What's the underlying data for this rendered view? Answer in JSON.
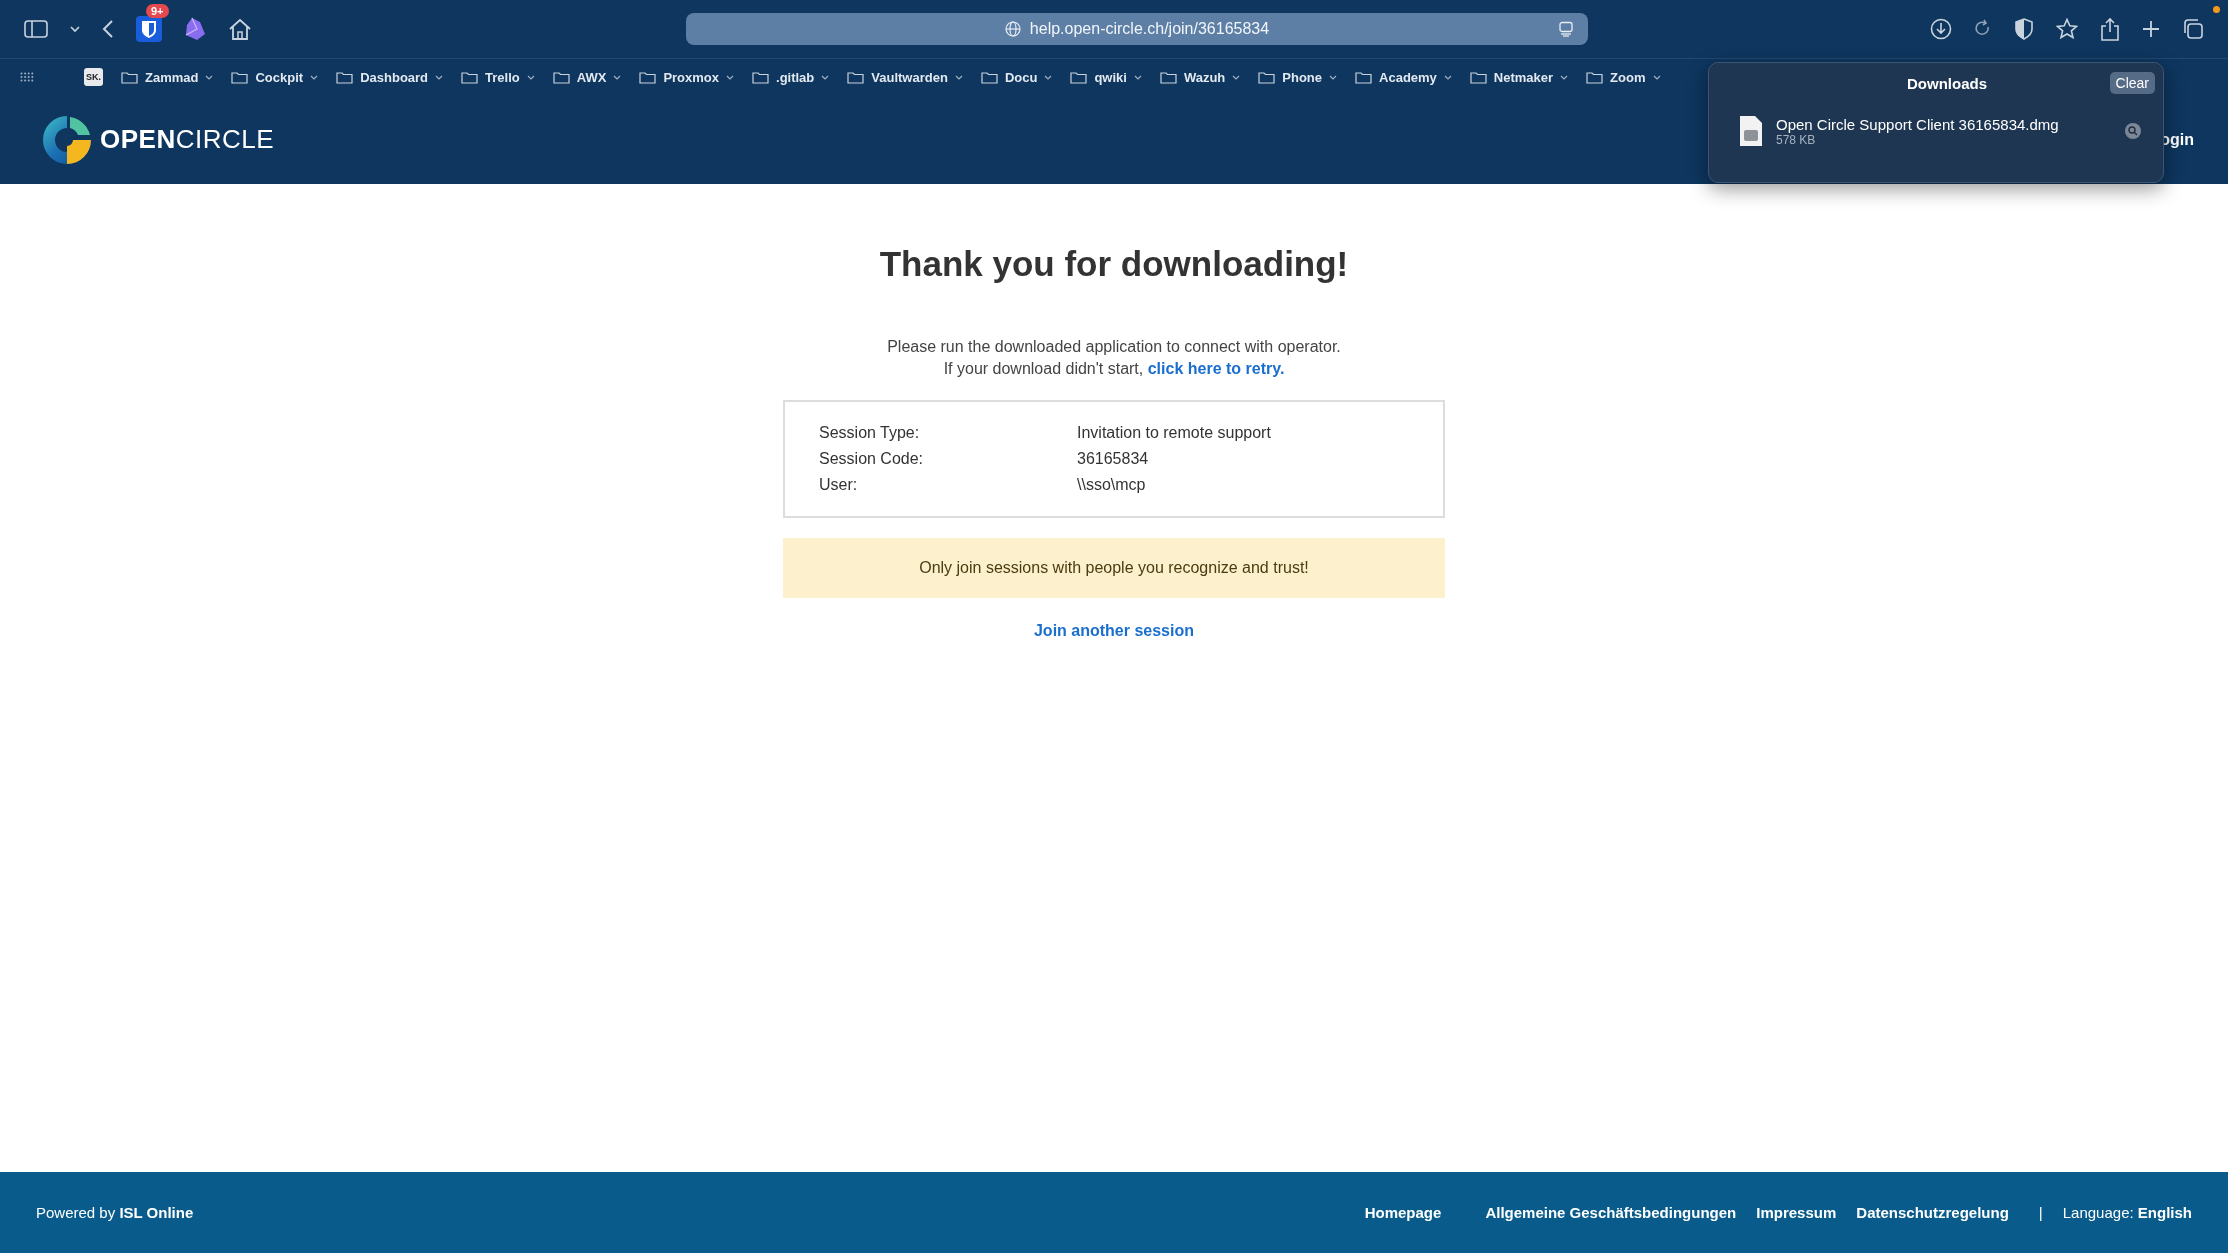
{
  "toolbar": {
    "extension_badge": "9+",
    "url": "help.open-circle.ch/join/36165834"
  },
  "bookmarks": {
    "favicon_text": "SK.",
    "folders": [
      "Zammad",
      "Cockpit",
      "Dashboard",
      "Trello",
      "AWX",
      "Proxmox",
      ".gitlab",
      "Vaultwarden",
      "Docu",
      "qwiki",
      "Wazuh",
      "Phone",
      "Academy",
      "Netmaker",
      "Zoom"
    ]
  },
  "site_header": {
    "logo": {
      "strong": "OPEN",
      "light": "CIRCLE"
    },
    "login": "ogin"
  },
  "downloads_popup": {
    "title": "Downloads",
    "clear": "Clear",
    "items": [
      {
        "name": "Open Circle Support Client 36165834.dmg",
        "size": "578 KB"
      }
    ]
  },
  "main": {
    "title": "Thank you for downloading!",
    "line_1": "Please run the downloaded application to connect with operator.",
    "line_2": "If your download didn't start,",
    "retry_link": "click here to retry.",
    "session": [
      {
        "label": "Session Type:",
        "value": "Invitation to remote support"
      },
      {
        "label": "Session Code:",
        "value": "36165834"
      },
      {
        "label": "User:",
        "value": "\\\\sso\\mcp"
      }
    ],
    "warning": "Only join sessions with people you recognize and trust!",
    "join_link": "Join another session"
  },
  "footer": {
    "powered": "Powered by **ISL Online**",
    "links": [
      "Homepage",
      "Allgemeine Geschäftsbedingungen",
      "Impressum",
      "Datenschutzregelung"
    ],
    "separator": "|",
    "language": "Language: **English**"
  }
}
